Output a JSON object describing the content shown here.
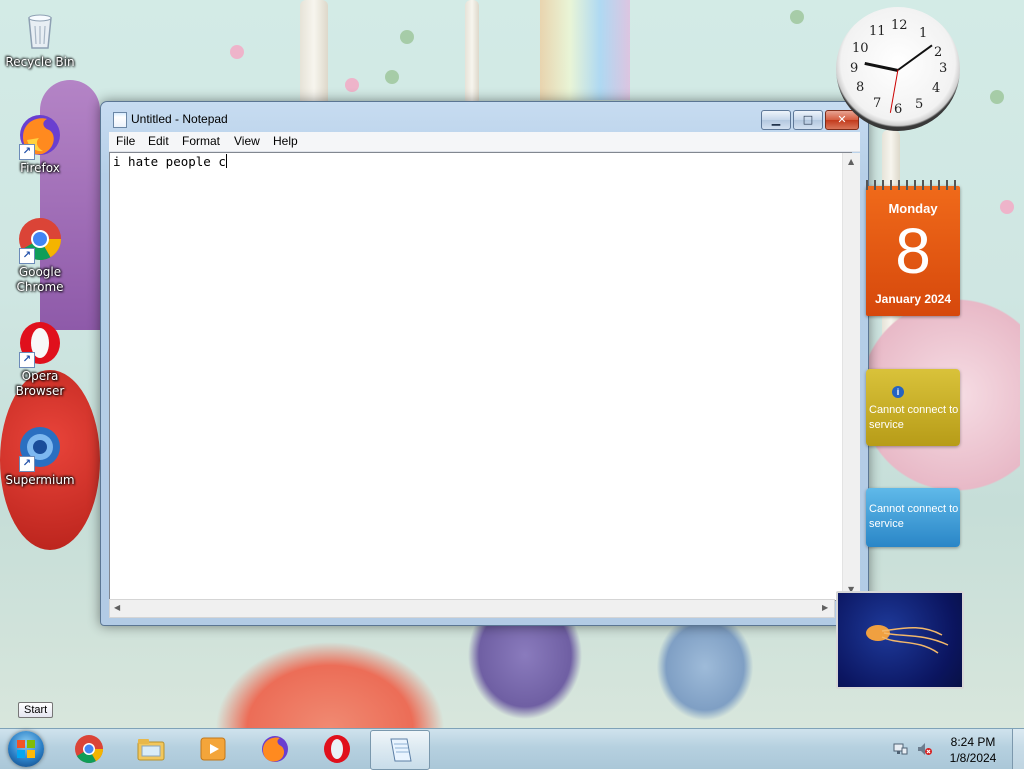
{
  "desktop": {
    "icons": [
      {
        "label": "Recycle Bin"
      },
      {
        "label": "Firefox"
      },
      {
        "label": "Google Chrome"
      },
      {
        "label": "Opera Browser"
      },
      {
        "label": "Supermium"
      }
    ]
  },
  "window": {
    "title": "Untitled - Notepad",
    "minimize_glyph": "▁",
    "maximize_glyph": "□",
    "close_glyph": "✕",
    "menu": [
      "File",
      "Edit",
      "Format",
      "View",
      "Help"
    ],
    "document_text": "i hate people c"
  },
  "gadgets": {
    "clock_numbers": [
      "12",
      "1",
      "2",
      "3",
      "4",
      "5",
      "6",
      "7",
      "8",
      "9",
      "10",
      "11"
    ],
    "calendar": {
      "day": "Monday",
      "date": "8",
      "month": "January 2024"
    },
    "weather_message": "Cannot connect to service",
    "currency_message": "Cannot connect to service"
  },
  "tooltip": "Start",
  "taskbar": {
    "pinned": [
      "Google Chrome",
      "Windows Explorer",
      "Windows Media Player",
      "Firefox",
      "Opera",
      "Notepad"
    ],
    "time": "8:24 PM",
    "date": "1/8/2024"
  },
  "colors": {
    "calendar_orange": "#e85a12",
    "weather_yellow": "#cdb22c",
    "currency_blue": "#3a9ad6",
    "window_frame": "#b6cfe8"
  }
}
